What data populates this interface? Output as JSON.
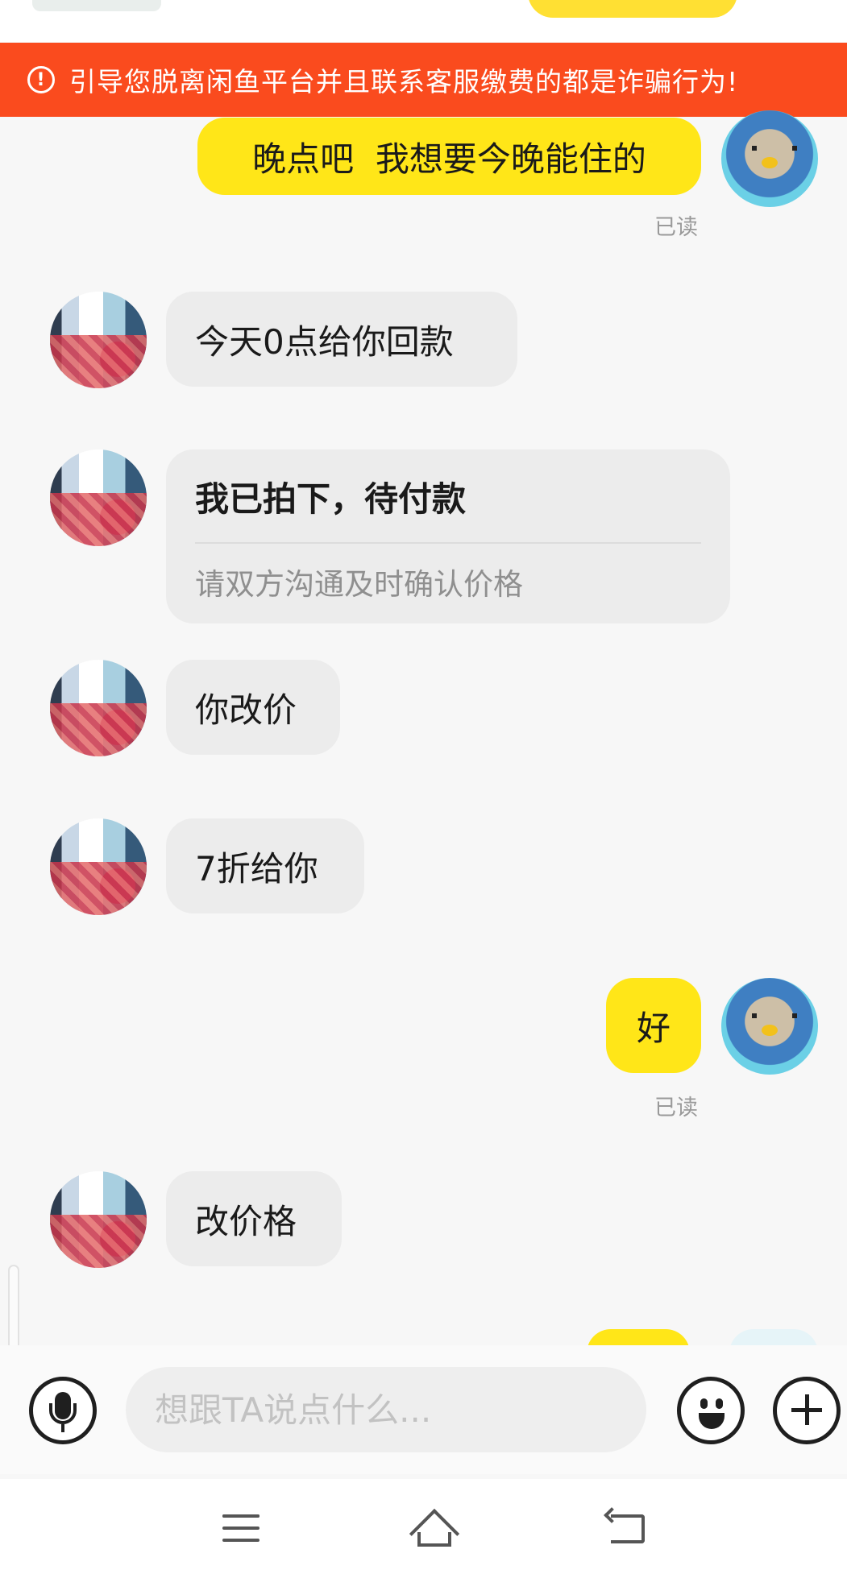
{
  "warning_banner": {
    "icon": "exclamation-circle-icon",
    "text": "引导您脱离闲鱼平台并且联系客服缴费的都是诈骗行为!"
  },
  "messages": [
    {
      "sender": "self",
      "text": "晚点吧  我想要今晚能住的",
      "status": "已读"
    },
    {
      "sender": "other",
      "text": "今天0点给你回款"
    },
    {
      "sender": "other",
      "type": "card",
      "title": "我已拍下，待付款",
      "subtitle": "请双方沟通及时确认价格"
    },
    {
      "sender": "other",
      "text": "你改价"
    },
    {
      "sender": "other",
      "text": "7折给你"
    },
    {
      "sender": "self",
      "text": "好",
      "status": "已读"
    },
    {
      "sender": "other",
      "text": "改价格"
    }
  ],
  "input_bar": {
    "placeholder": "想跟TA说点什么...",
    "value": ""
  },
  "colors": {
    "warning_bg": "#fa4b1e",
    "self_bubble": "#ffe618",
    "other_bubble": "#ececec",
    "background": "#f7f7f7"
  }
}
